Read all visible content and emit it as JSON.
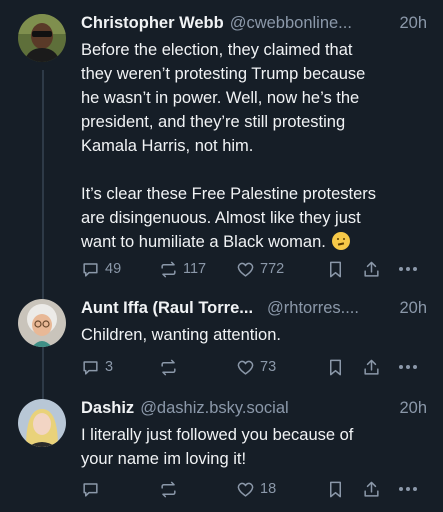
{
  "posts": [
    {
      "author_name": "Christopher Webb",
      "handle": "@cwebbonline...",
      "time": "20h",
      "lines": [
        "Before the election, they claimed that",
        "they weren’t protesting Trump because",
        "he wasn’t in power. Well, now he’s the",
        "president, and they’re still protesting",
        "Kamala Harris, not him.",
        "",
        "It’s clear these Free Palestine protesters",
        "are disingenuous. Almost like they just",
        "want to humiliate a Black woman."
      ],
      "emoji": "thinking-face",
      "replies": "49",
      "reposts": "117",
      "likes": "772"
    },
    {
      "author_name": "Aunt Iffa (Raul Torre...",
      "handle": "@rhtorres....",
      "time": "20h",
      "lines": [
        "Children, wanting attention."
      ],
      "replies": "3",
      "reposts": "",
      "likes": "73"
    },
    {
      "author_name": "Dashiz",
      "handle": "@dashiz.bsky.social",
      "time": "20h",
      "lines": [
        "I literally just followed you because of",
        "your name im loving it!"
      ],
      "replies": "",
      "reposts": "",
      "likes": "18"
    }
  ],
  "icons": {
    "reply": "reply-icon",
    "repost": "repost-icon",
    "like": "heart-icon",
    "save": "bookmark-icon",
    "share": "share-icon",
    "more": "more-icon"
  },
  "colors": {
    "background": "#161e27",
    "text": "#f1f3f5",
    "muted": "#8b98a9",
    "thread_line": "#2e3a47"
  }
}
